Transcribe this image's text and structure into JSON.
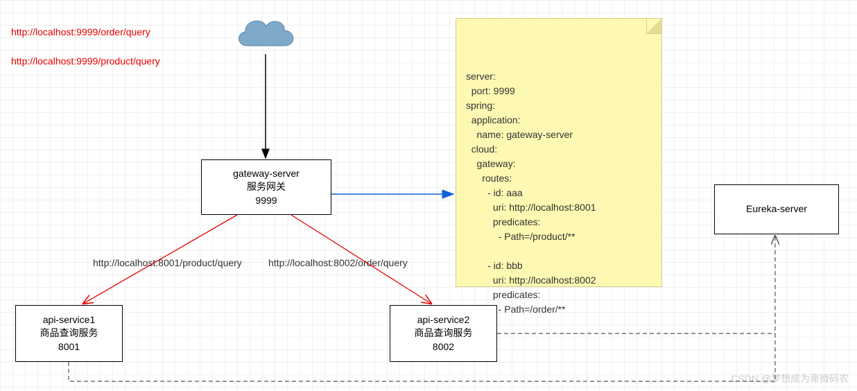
{
  "links": {
    "order": "http://localhost:9999/order/query",
    "product": "http://localhost:9999/product/query"
  },
  "gateway": {
    "l1": "gateway-server",
    "l2": "服务网关",
    "l3": "9999"
  },
  "api1": {
    "l1": "api-service1",
    "l2": "商品查询服务",
    "l3": "8001"
  },
  "api2": {
    "l1": "api-service2",
    "l2": "商品查询服务",
    "l3": "8002"
  },
  "eureka": {
    "l1": "Eureka-server"
  },
  "edges": {
    "left": "http://localhost:8001/product/query",
    "right": "http://localhost:8002/order/query"
  },
  "note": "server:\n  port: 9999\nspring:\n  application:\n    name: gateway-server\n  cloud:\n    gateway:\n      routes:\n        - id: aaa\n          uri: http://localhost:8001\n          predicates:\n            - Path=/product/**\n\n        - id: bbb\n          uri: http://localhost:8002\n          predicates:\n            - Path=/order/**",
  "watermark": "CSDN @梦想成为卑微码农"
}
